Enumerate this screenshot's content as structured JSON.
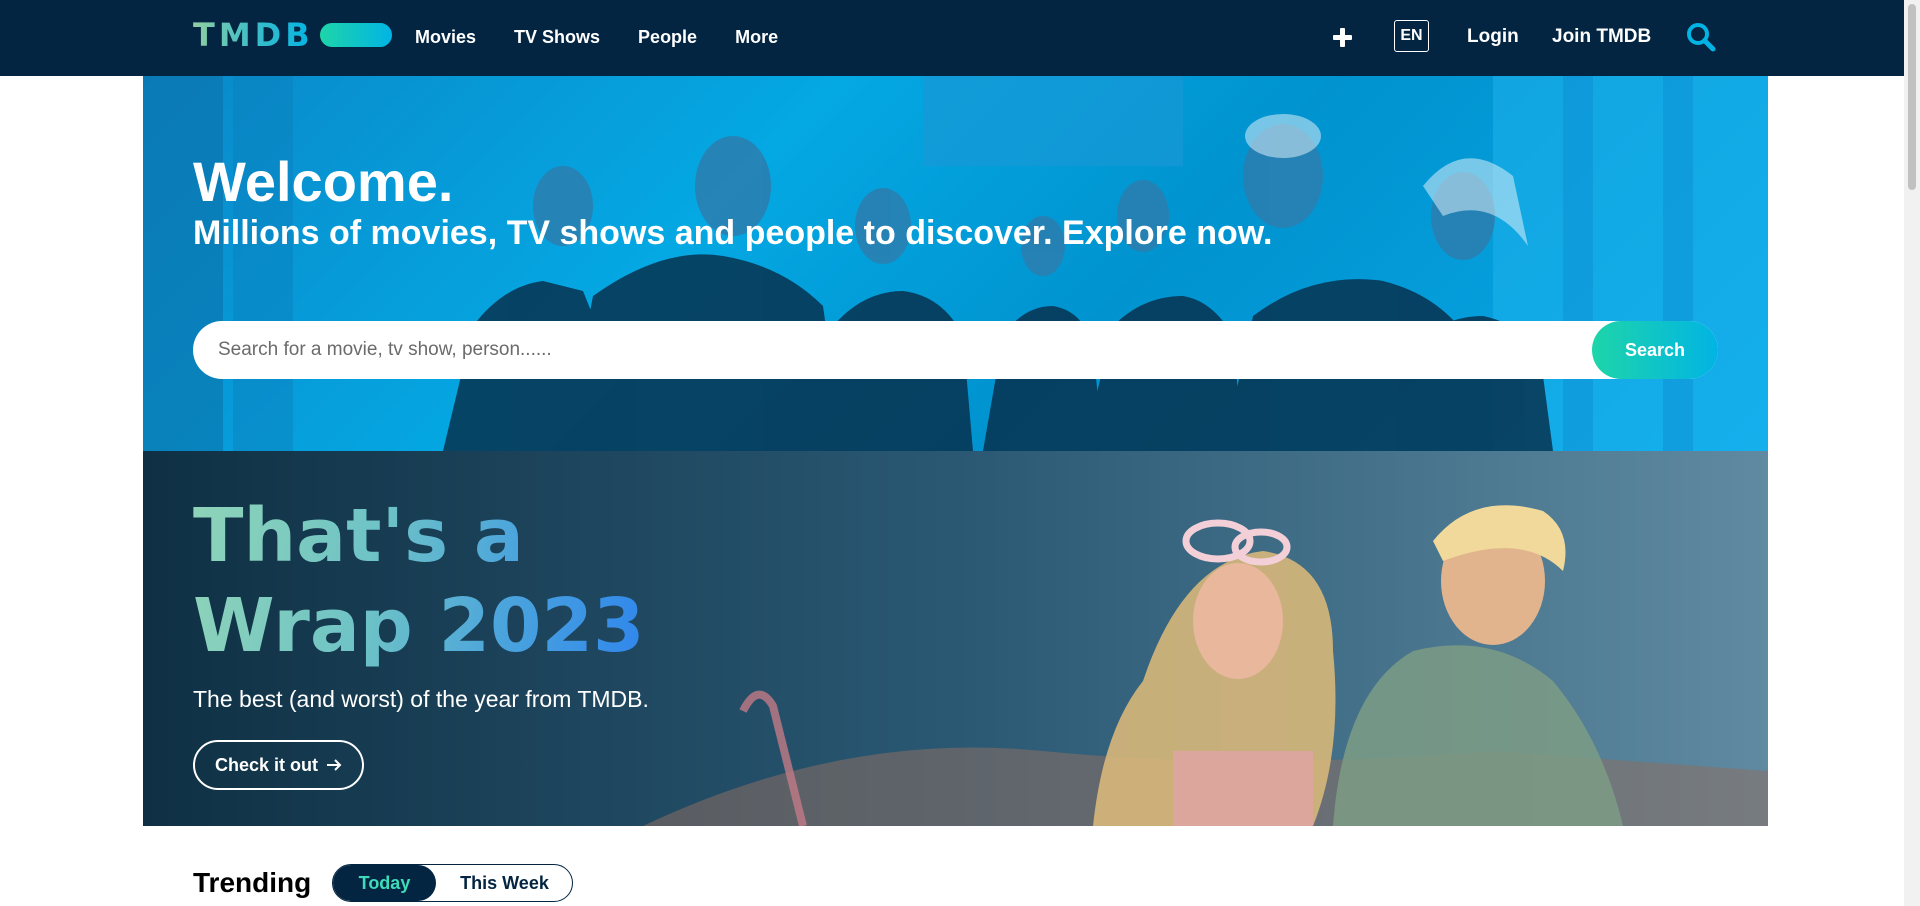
{
  "header": {
    "logo_text": "TMDB",
    "nav": [
      "Movies",
      "TV Shows",
      "People",
      "More"
    ],
    "lang": "EN",
    "login": "Login",
    "join": "Join TMDB"
  },
  "hero": {
    "title": "Welcome.",
    "subtitle": "Millions of movies, TV shows and people to discover. Explore now.",
    "search_placeholder": "Search for a movie, tv show, person......",
    "search_button": "Search"
  },
  "wrap": {
    "title_line1": "That's a",
    "title_line2": "Wrap 2023",
    "subtitle": "The best (and worst) of the year from TMDB.",
    "button": "Check it out"
  },
  "trending": {
    "title": "Trending",
    "toggle_today": "Today",
    "toggle_week": "This Week"
  },
  "colors": {
    "header_bg": "#032541",
    "accent_green": "#1ed5a9",
    "accent_blue": "#01b4e4"
  },
  "icons": [
    "plus-icon",
    "search-icon",
    "arrow-right-icon"
  ]
}
